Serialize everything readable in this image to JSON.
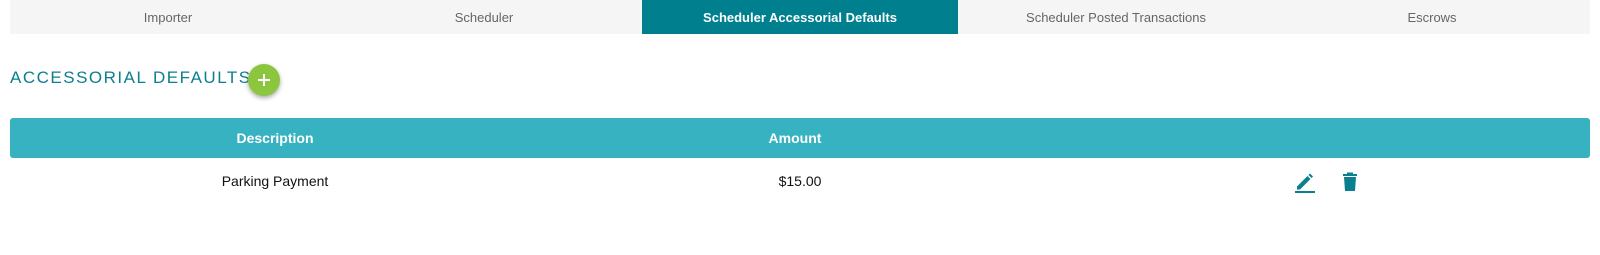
{
  "tabs": [
    {
      "label": "Importer",
      "active": false
    },
    {
      "label": "Scheduler",
      "active": false
    },
    {
      "label": "Scheduler Accessorial Defaults",
      "active": true
    },
    {
      "label": "Scheduler Posted Transactions",
      "active": false
    },
    {
      "label": "Escrows",
      "active": false
    }
  ],
  "section": {
    "title": "ACCESSORIAL DEFAULTS",
    "add_icon": "plus-icon"
  },
  "table": {
    "columns": [
      "Description",
      "Amount",
      ""
    ],
    "rows": [
      {
        "description": "Parking Payment",
        "amount": "$15.00",
        "actions": [
          "edit-icon",
          "delete-icon"
        ]
      }
    ]
  },
  "colors": {
    "accent": "#007f8f",
    "header_bg": "#37b2c1",
    "add_button": "#8cc63f",
    "title": "#0b7f8f"
  }
}
